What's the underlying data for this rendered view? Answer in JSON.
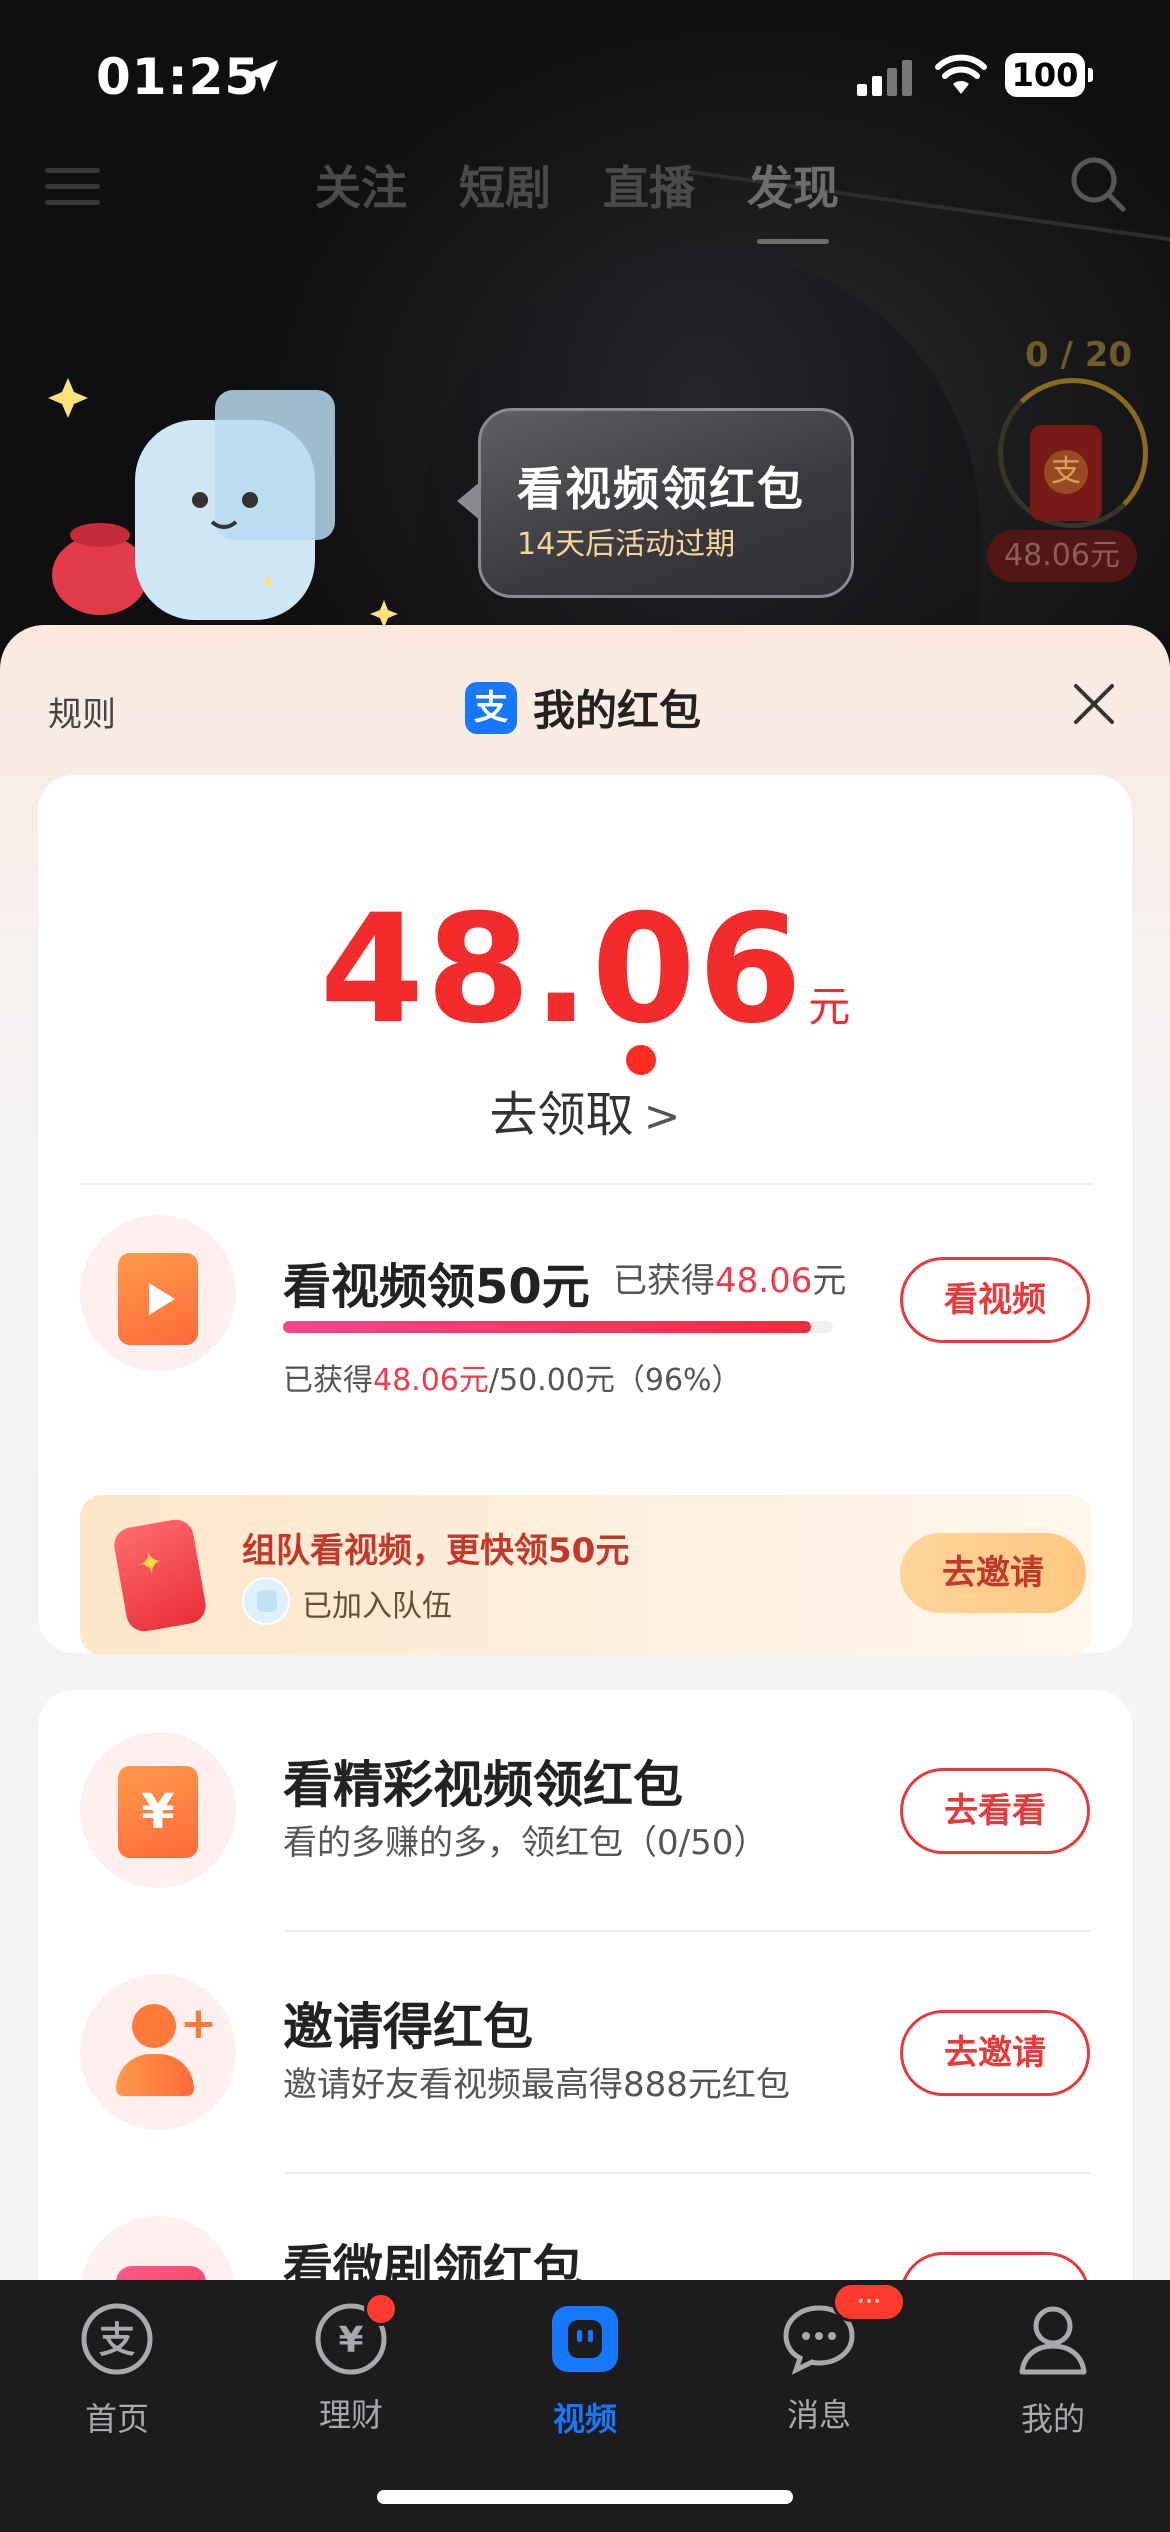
{
  "status_bar": {
    "time": "01:25",
    "battery": "100"
  },
  "top_nav": {
    "tabs": [
      {
        "label": "关注"
      },
      {
        "label": "短剧"
      },
      {
        "label": "直播"
      },
      {
        "label": "发现",
        "active": true
      }
    ]
  },
  "promo": {
    "title": "看视频领红包",
    "subtitle": "14天后活动过期",
    "progress_count": "0 / 20",
    "amount_badge": "48.06元"
  },
  "sheet": {
    "rules_label": "规则",
    "logo_glyph": "支",
    "title": "我的红包",
    "balance": "48.06",
    "balance_unit": "元",
    "claim_label": "去领取",
    "claim_chevron": ">",
    "main_task": {
      "title": "看视频领50元",
      "earned_prefix": "已获得",
      "earned_value": "48.06",
      "earned_unit": "元",
      "progress_percent": 96,
      "detail_prefix": "已获得",
      "detail_value": "48.06元",
      "detail_suffix": "/50.00元（96%）",
      "button": "看视频"
    },
    "team": {
      "title": "组队看视频，更快领50元",
      "status": "已加入队伍",
      "button": "去邀请"
    },
    "tasks": [
      {
        "title": "看精彩视频领红包",
        "subtitle": "看的多赚的多，领红包（0/50）",
        "button": "去看看",
        "icon": "yen-icon"
      },
      {
        "title": "邀请得红包",
        "subtitle": "邀请好友看视频最高得888元红包",
        "button": "去邀请",
        "icon": "invite-user-icon"
      },
      {
        "title": "看微剧领红包",
        "icon": "tv-icon"
      }
    ]
  },
  "tab_bar": {
    "items": [
      {
        "label": "首页",
        "icon": "alipay-home-icon"
      },
      {
        "label": "理财",
        "icon": "wealth-icon",
        "badge": "dot"
      },
      {
        "label": "视频",
        "icon": "video-icon",
        "active": true
      },
      {
        "label": "消息",
        "icon": "message-icon",
        "badge": "···"
      },
      {
        "label": "我的",
        "icon": "profile-icon"
      }
    ]
  },
  "colors": {
    "accent_red": "#f22c2c",
    "brand_blue": "#1677ff",
    "tab_bar_bg": "#1c1c1e"
  }
}
